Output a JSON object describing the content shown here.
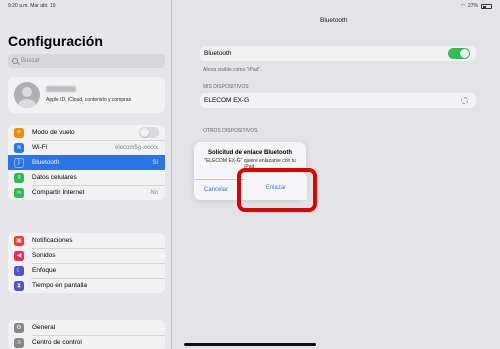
{
  "status_bar": {
    "time": "9:20 a.m.  Mar abr. 19",
    "battery": "27%"
  },
  "sidebar": {
    "title": "Configuración",
    "search_placeholder": "Buscar",
    "profile": {
      "subtitle": "Apple ID, iCloud, contenido y compras"
    },
    "group1": [
      {
        "label": "Modo de vuelo",
        "icon": "airplane-icon",
        "color": "#ff9500",
        "value": ""
      },
      {
        "label": "Wi-Fi",
        "icon": "wifi-icon",
        "color": "#2f7cf6",
        "value": "elecom5g-xxxxx"
      },
      {
        "label": "Bluetooth",
        "icon": "bluetooth-icon",
        "color": "#2f7cf6",
        "value": "Sí"
      },
      {
        "label": "Datos celulares",
        "icon": "antenna-icon",
        "color": "#34c759",
        "value": ""
      },
      {
        "label": "Compartir Internet",
        "icon": "link-icon",
        "color": "#34c759",
        "value": "No"
      }
    ],
    "group2": [
      {
        "label": "Notificaciones",
        "icon": "bell-icon",
        "color": "#ff3b30"
      },
      {
        "label": "Sonidos",
        "icon": "speaker-icon",
        "color": "#ff2d55"
      },
      {
        "label": "Enfoque",
        "icon": "moon-icon",
        "color": "#5856d6"
      },
      {
        "label": "Tiempo en pantalla",
        "icon": "hourglass-icon",
        "color": "#5856d6"
      }
    ],
    "group3": [
      {
        "label": "General",
        "icon": "gear-icon",
        "color": "#8e8e93"
      },
      {
        "label": "Centro de control",
        "icon": "sliders-icon",
        "color": "#8e8e93"
      }
    ]
  },
  "detail": {
    "title": "Bluetooth",
    "bluetooth_label": "Bluetooth",
    "visible_note": "Ahora visible como \"iPad\".",
    "my_devices_header": "MIS DISPOSITIVOS",
    "device_name": "ELECOM EX-G",
    "other_devices_header": "OTROS DISPOSITIVOS"
  },
  "alert": {
    "title": "Solicitud de enlace Bluetooth",
    "message": "\"ELECOM EX-G\" quiere enlazarse con tu iPad.",
    "cancel_label": "Cancelar",
    "pair_label": "Enlazar"
  }
}
